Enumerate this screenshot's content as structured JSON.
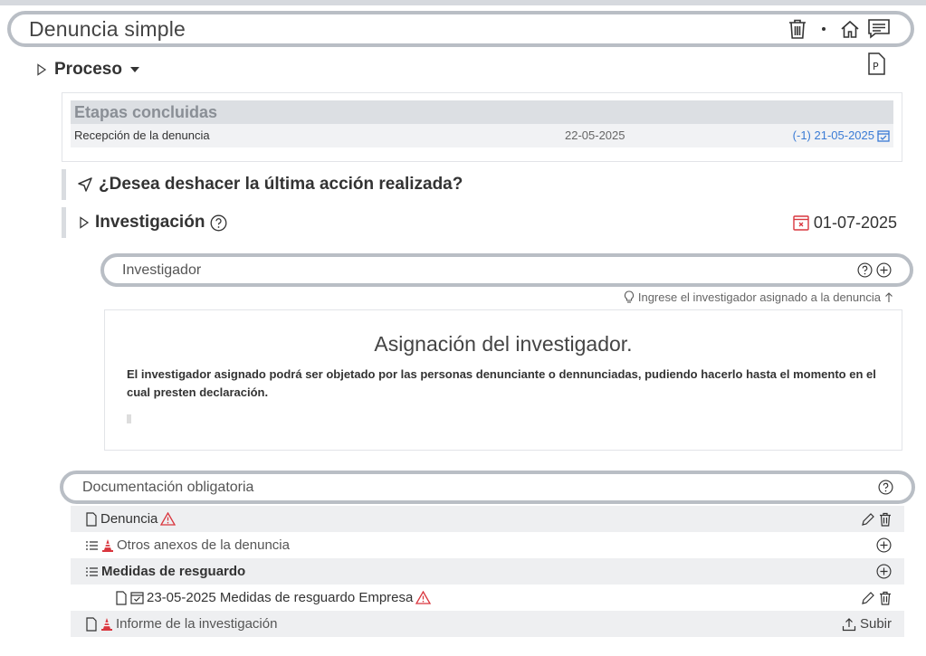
{
  "header": {
    "title": "Denuncia simple"
  },
  "process": {
    "label": "Proceso"
  },
  "etapas": {
    "heading": "Etapas concluidas",
    "rows": [
      {
        "name": "Recepción de la denuncia",
        "date": "22-05-2025",
        "due": "(-1) 21-05-2025"
      }
    ]
  },
  "undo": {
    "question": "¿Desea deshacer la última acción realizada?"
  },
  "investigation": {
    "label": "Investigación",
    "date": "01-07-2025"
  },
  "investigator_field": {
    "label": "Investigador",
    "hint": "Ingrese el investigador asignado a la denuncia"
  },
  "assignment": {
    "heading": "Asignación del investigador.",
    "body": "El investigador asignado podrá ser objetado por las personas denunciante o dennunciadas, pudiendo hacerlo hasta el momento en el cual presten declaración."
  },
  "documentation": {
    "label": "Documentación obligatoria",
    "items": [
      {
        "label": "Denuncia"
      },
      {
        "label": "Otros anexos de la denuncia"
      },
      {
        "label": "Medidas de resguardo"
      },
      {
        "label": "23-05-2025 Medidas de resguardo Empresa"
      },
      {
        "label": "Informe de la investigación",
        "action": "Subir"
      }
    ]
  },
  "colors": {
    "accent_blue": "#3a7bd5",
    "alert_red": "#d9363e",
    "pill_border": "#b9bec5"
  }
}
